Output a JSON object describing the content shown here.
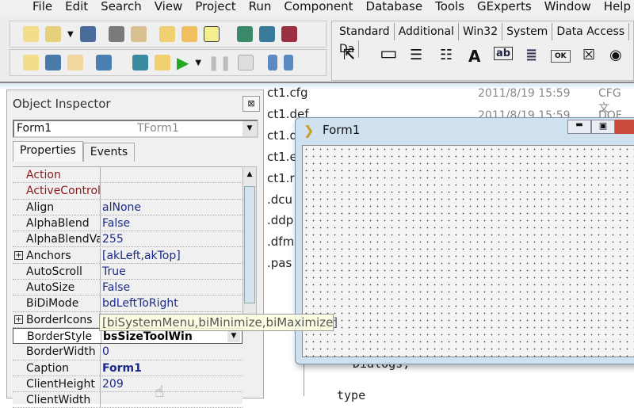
{
  "menu": [
    "File",
    "Edit",
    "Search",
    "View",
    "Project",
    "Run",
    "Component",
    "Database",
    "Tools",
    "GExperts",
    "Window",
    "Help"
  ],
  "palette": {
    "tabs": [
      "Standard",
      "Additional",
      "Win32",
      "System",
      "Data Access",
      "Da"
    ],
    "active_tab": "Standard",
    "components": [
      {
        "icon": "pointer-arrow",
        "glyph": "⇱"
      },
      {
        "icon": "frame",
        "glyph": "▭"
      },
      {
        "icon": "main-menu",
        "glyph": "☰"
      },
      {
        "icon": "popup-menu",
        "glyph": "☷"
      },
      {
        "icon": "label",
        "glyph": "A"
      },
      {
        "icon": "edit",
        "glyph": "ab"
      },
      {
        "icon": "memo",
        "glyph": "≣"
      },
      {
        "icon": "button",
        "glyph": "OK"
      },
      {
        "icon": "checkbox",
        "glyph": "☒"
      },
      {
        "icon": "radio-button",
        "glyph": "◉"
      }
    ]
  },
  "background_files": {
    "names": [
      "ct1.cfg",
      "ct1.def",
      "ct1.d",
      "ct1.e",
      "ct1.r",
      ".dcu",
      ".ddp",
      ".dfm",
      ".pas"
    ],
    "dates": [
      "2011/8/19 15:59",
      "2011/8/19 15:59"
    ],
    "types": [
      "CFG 文",
      "DOF 文"
    ]
  },
  "inspector": {
    "title": "Object Inspector",
    "object_name": "Form1",
    "object_type": "TForm1",
    "tabs": [
      "Properties",
      "Events"
    ],
    "rows": [
      {
        "name": "Action",
        "value": "",
        "ref": true
      },
      {
        "name": "ActiveControl",
        "value": "",
        "ref": true
      },
      {
        "name": "Align",
        "value": "alNone"
      },
      {
        "name": "AlphaBlend",
        "value": "False"
      },
      {
        "name": "AlphaBlendValue",
        "value": "255"
      },
      {
        "name": "Anchors",
        "value": "[akLeft,akTop]",
        "expandable": true
      },
      {
        "name": "AutoScroll",
        "value": "True"
      },
      {
        "name": "AutoSize",
        "value": "False"
      },
      {
        "name": "BiDiMode",
        "value": "bdLeftToRight"
      },
      {
        "name": "BorderIcons",
        "value": "[biSystemMenu,biMinimize,biMaximize]",
        "expandable": true
      },
      {
        "name": "BorderStyle",
        "value": "bsSizeToolWin",
        "selected": true
      },
      {
        "name": "BorderWidth",
        "value": "0"
      },
      {
        "name": "Caption",
        "value": "Form1",
        "bold": true
      },
      {
        "name": "ClientHeight",
        "value": "209"
      },
      {
        "name": "ClientWidth",
        "value": ""
      }
    ]
  },
  "tooltip": "[biSystemMenu,biMinimize,biMaximize]",
  "form": {
    "title": "Form1"
  },
  "code": [
    "Dialogs;",
    "type"
  ]
}
